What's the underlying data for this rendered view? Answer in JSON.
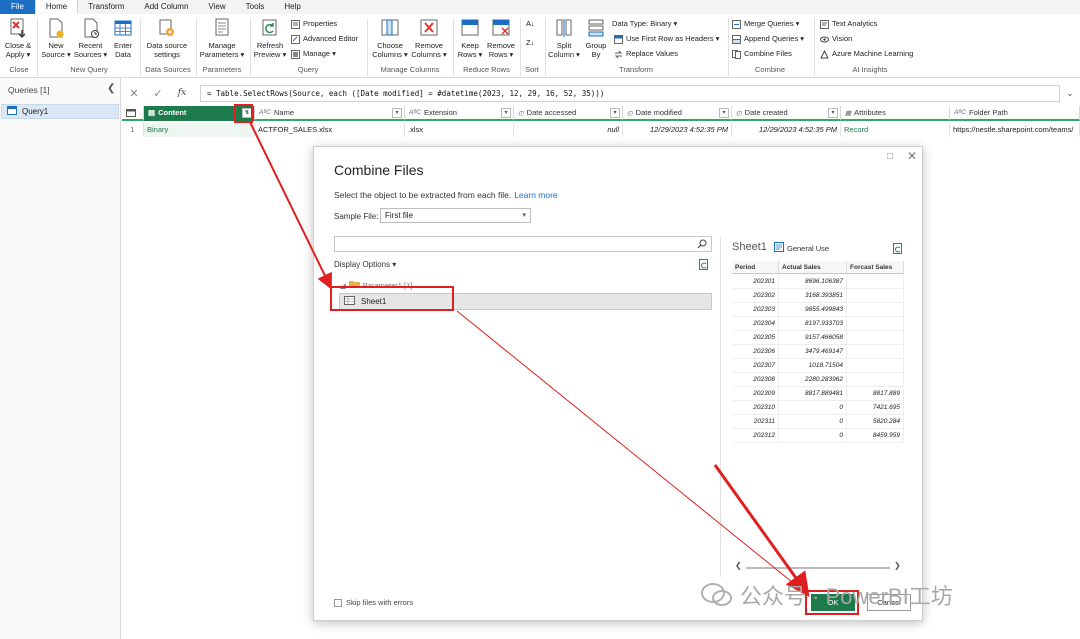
{
  "menu": {
    "tabs": [
      "File",
      "Home",
      "Transform",
      "Add Column",
      "View",
      "Tools",
      "Help"
    ],
    "active": "Home"
  },
  "ribbon": {
    "close_apply": [
      "Close &",
      "Apply ▾"
    ],
    "new_source": [
      "New",
      "Source ▾"
    ],
    "recent_sources": [
      "Recent",
      "Sources ▾"
    ],
    "enter_data": [
      "Enter",
      "Data"
    ],
    "data_source_settings": [
      "Data source",
      "settings"
    ],
    "manage_parameters": [
      "Manage",
      "Parameters ▾"
    ],
    "refresh_preview": [
      "Refresh",
      "Preview ▾"
    ],
    "properties": "Properties",
    "advanced_editor": "Advanced Editor",
    "manage": "Manage ▾",
    "choose_columns": [
      "Choose",
      "Columns ▾"
    ],
    "remove_columns": [
      "Remove",
      "Columns ▾"
    ],
    "keep_rows": [
      "Keep",
      "Rows ▾"
    ],
    "remove_rows": [
      "Remove",
      "Rows ▾"
    ],
    "split_column": [
      "Split",
      "Column ▾"
    ],
    "group_by": [
      "Group",
      "By"
    ],
    "data_type": "Data Type: Binary ▾",
    "first_row_headers": "Use First Row as Headers ▾",
    "replace_values": "Replace Values",
    "merge_queries": "Merge Queries ▾",
    "append_queries": "Append Queries ▾",
    "combine_files": "Combine Files",
    "text_analytics": "Text Analytics",
    "vision": "Vision",
    "azure_ml": "Azure Machine Learning",
    "groups": {
      "close": "Close",
      "new_query": "New Query",
      "data_sources": "Data Sources",
      "parameters": "Parameters",
      "query": "Query",
      "manage_columns": "Manage Columns",
      "reduce_rows": "Reduce Rows",
      "sort": "Sort",
      "transform": "Transform",
      "combine": "Combine",
      "ai_insights": "AI Insights"
    }
  },
  "formula": {
    "text": "= Table.SelectRows(Source, each ([Date modified] = #datetime(2023, 12, 29, 16, 52, 35)))",
    "fx": "fx"
  },
  "queries": {
    "header": "Queries [1]",
    "items": [
      "Query1"
    ]
  },
  "grid": {
    "columns": [
      "Content",
      "Name",
      "Extension",
      "Date accessed",
      "Date modified",
      "Date created",
      "Attributes",
      "Folder Path"
    ],
    "row_number": "1",
    "row": [
      "Binary",
      "ACTFOR_SALES.xlsx",
      ".xlsx",
      "null",
      "12/29/2023 4:52:35 PM",
      "12/29/2023 4:52:35 PM",
      "Record",
      "https://nestle.sharepoint.com/teams/"
    ]
  },
  "dialog": {
    "title": "Combine Files",
    "description": "Select the object to be extracted from each file.",
    "learn_more": "Learn more",
    "sample_file_label": "Sample File:",
    "sample_file_value": "First file",
    "display_options": "Display Options ▾",
    "tree_parent": "Parameter1 [1]",
    "tree_item": "Sheet1",
    "skip_errors": "Skip files with errors",
    "ok": "OK",
    "cancel": "Cancel",
    "preview": {
      "title": "Sheet1",
      "general_use": "General Use",
      "columns": [
        "Period",
        "Actual Sales",
        "Forcast Sales"
      ],
      "rows": [
        [
          "202301",
          "8696.106387",
          ""
        ],
        [
          "202302",
          "3168.393851",
          ""
        ],
        [
          "202303",
          "9855.499843",
          ""
        ],
        [
          "202304",
          "8197.933703",
          ""
        ],
        [
          "202305",
          "9157.466058",
          ""
        ],
        [
          "202306",
          "3479.469147",
          ""
        ],
        [
          "202307",
          "1018.71504",
          ""
        ],
        [
          "202308",
          "2280.283962",
          ""
        ],
        [
          "202309",
          "8817.889481",
          "8817.889"
        ],
        [
          "202310",
          "0",
          "7421.695"
        ],
        [
          "202311",
          "0",
          "5820.284"
        ],
        [
          "202312",
          "0",
          "8459.959"
        ]
      ]
    }
  },
  "watermark": "公众号 · PowerBI工坊",
  "colors": {
    "accent_green": "#1d7a4a",
    "file_blue": "#1b6ec2",
    "annotation_red": "#e02020"
  }
}
